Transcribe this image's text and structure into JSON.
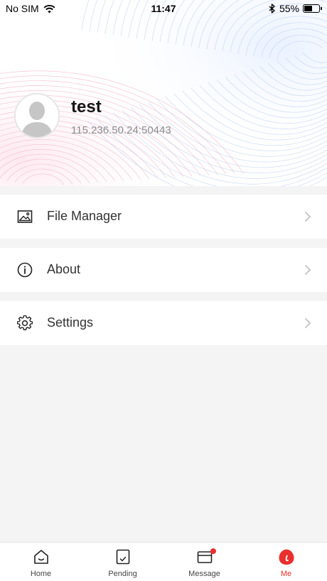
{
  "status_bar": {
    "carrier": "No SIM",
    "time": "11:47",
    "battery_percent": "55%",
    "battery_level": 0.55
  },
  "profile": {
    "username": "test",
    "server_address": "115.236.50.24:50443",
    "avatar_icon": "person-silhouette-icon"
  },
  "menu": [
    {
      "label": "File Manager",
      "icon": "image-icon"
    },
    {
      "label": "About",
      "icon": "info-icon"
    },
    {
      "label": "Settings",
      "icon": "gear-icon"
    }
  ],
  "tabs": [
    {
      "label": "Home",
      "icon": "home-icon",
      "active": false
    },
    {
      "label": "Pending",
      "icon": "pending-icon",
      "active": false
    },
    {
      "label": "Message",
      "icon": "mail-icon",
      "active": false,
      "badge": true
    },
    {
      "label": "Me",
      "icon": "me-icon",
      "active": true
    }
  ],
  "colors": {
    "accent": "#e8302f",
    "page_background": "#f4f4f4",
    "secondary_text": "#8c8c8c"
  }
}
